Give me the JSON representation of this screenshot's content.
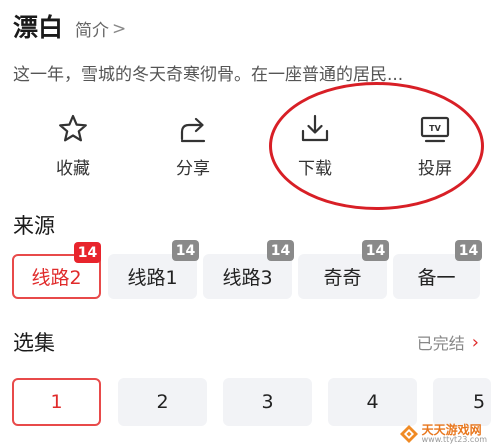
{
  "header": {
    "title": "漂白",
    "intro_label": "简介",
    "intro_chevron": ">"
  },
  "description": "这一年，雪城的冬天奇寒彻骨。在一座普通的居民...",
  "actions": [
    {
      "label": "收藏",
      "icon": "star-icon"
    },
    {
      "label": "分享",
      "icon": "share-icon"
    },
    {
      "label": "下载",
      "icon": "download-icon"
    },
    {
      "label": "投屏",
      "icon": "tv-cast-icon"
    }
  ],
  "highlight_color": "#d81f26",
  "sources": {
    "title": "来源",
    "items": [
      {
        "label": "线路2",
        "badge": "14",
        "selected": true
      },
      {
        "label": "线路1",
        "badge": "14",
        "selected": false
      },
      {
        "label": "线路3",
        "badge": "14",
        "selected": false
      },
      {
        "label": "奇奇",
        "badge": "14",
        "selected": false
      },
      {
        "label": "备一",
        "badge": "14",
        "selected": false
      }
    ]
  },
  "episodes": {
    "title": "选集",
    "status": "已完结",
    "status_chevron": "›",
    "items": [
      {
        "label": "1",
        "selected": true
      },
      {
        "label": "2",
        "selected": false
      },
      {
        "label": "3",
        "selected": false
      },
      {
        "label": "4",
        "selected": false
      },
      {
        "label": "5",
        "selected": false
      }
    ]
  },
  "watermark": {
    "name": "天天游戏网",
    "url": "www.ttyt23.com"
  }
}
